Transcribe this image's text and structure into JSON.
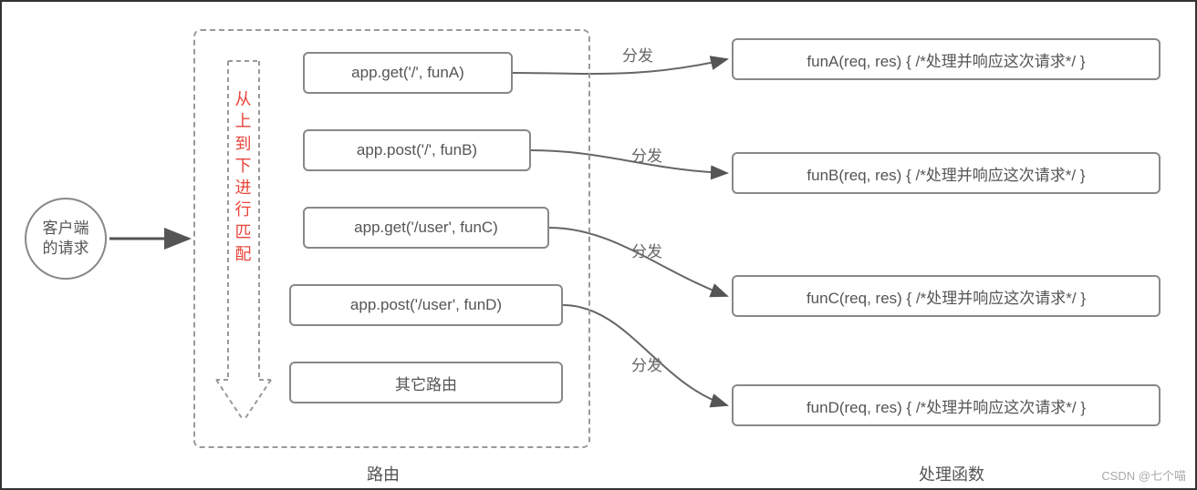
{
  "client": "客户端\n的请求",
  "verticalText": "从上到下进行匹配",
  "routes": [
    "app.get('/', funA)",
    "app.post('/', funB)",
    "app.get('/user', funC)",
    "app.post('/user', funD)",
    "其它路由"
  ],
  "handlers": [
    "funA(req, res) { /*处理并响应这次请求*/ }",
    "funB(req, res) { /*处理并响应这次请求*/ }",
    "funC(req, res) { /*处理并响应这次请求*/ }",
    "funD(req, res) { /*处理并响应这次请求*/ }"
  ],
  "dispatchLabel": "分发",
  "bottomLabels": {
    "route": "路由",
    "handler": "处理函数"
  },
  "watermark": "CSDN @七个喵"
}
